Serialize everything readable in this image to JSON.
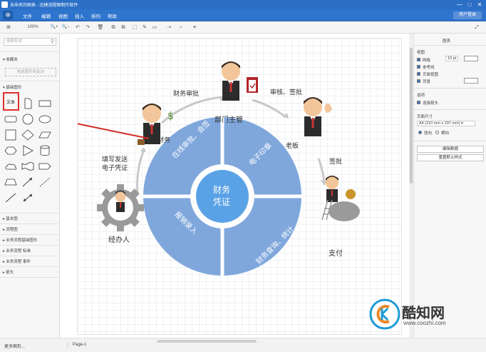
{
  "window": {
    "title": "未命名的图表 - 迅捷流程图制作软件",
    "controls": [
      "—",
      "□",
      "✕"
    ]
  },
  "menubar": {
    "items": [
      "文件",
      "编辑",
      "视图",
      "插入",
      "排列",
      "帮助"
    ],
    "signin": "用户登录"
  },
  "toolbar": {
    "zoom": "100%",
    "items": [
      "⊞",
      "🔍+",
      "🔍−",
      "↶",
      "↷",
      "🗑",
      "⧉",
      "⧉",
      "⬚",
      "✎",
      "▭",
      "⇢",
      "⌐",
      "+"
    ]
  },
  "sidebar": {
    "search_placeholder": "搜索形状",
    "favorites_header": "收藏夹",
    "favorites_drop": "拖放图形到此处",
    "basic_header": "基础图形",
    "text_shape_label": "文本",
    "categories": [
      "基本图",
      "流程图",
      "业务流程基础图形",
      "业务流程 标准",
      "业务流程 事件",
      "箭头"
    ],
    "more_shapes": "更多图形..."
  },
  "diagram": {
    "center": [
      "财务",
      "凭证"
    ],
    "segments": [
      "在线审批、会签",
      "电子印章",
      "报销录入",
      "财务查询、统计"
    ],
    "labels": {
      "finance_approval": "财务审批",
      "department_head": "部门主管",
      "review_sign": "审核、签批",
      "finance": "财务",
      "boss": "老板",
      "fill_send_1": "填写发送",
      "fill_send_2": "电子凭证",
      "sign_approve": "签批",
      "handler": "经办人",
      "pay": "支付"
    }
  },
  "rpanel": {
    "header": "图表",
    "view_section": "视图",
    "grid": "网格",
    "grid_size": "10 pt",
    "guides": "参考线",
    "page_view": "页面视图",
    "background": "背景",
    "options_section": "选项",
    "connection_arrows": "连接箭头",
    "paper_size_section": "页面尺寸",
    "paper_size": "A4 (210 mm x 297 mm)",
    "portrait": "竖向",
    "landscape": "横向",
    "edit_data_btn": "编辑数据",
    "reset_style_btn": "重置默认样式"
  },
  "status": {
    "page_tab": "Page-1"
  },
  "watermark": {
    "brand": "酷知网",
    "url": "www.coozhi.com"
  },
  "colors": {
    "accent": "#2f74cd",
    "segment": "#7fa7dc",
    "center": "#5aa2e6",
    "highlight": "#e0302a"
  }
}
